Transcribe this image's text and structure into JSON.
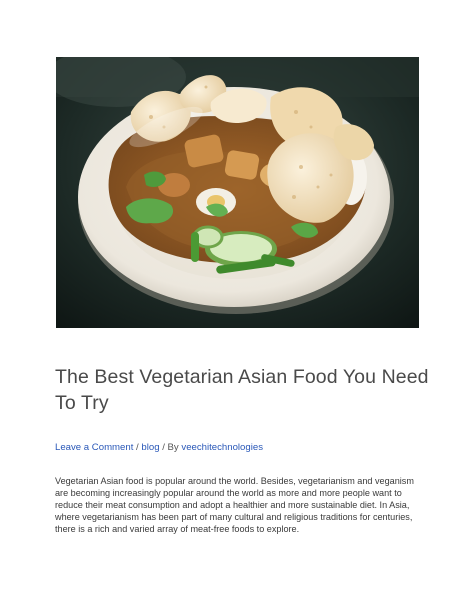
{
  "article": {
    "image_alt": "Vegetarian Asian dish with prawn crackers, vegetables and peanut sauce on a white plate",
    "title": "The Best Vegetarian Asian Food You Need To Try",
    "meta": {
      "comment_link": "Leave a Comment",
      "separator_1": " / ",
      "category_link": "blog",
      "separator_2": " / By ",
      "author_link": "veechitechnologies"
    },
    "intro": "Vegetarian Asian food is popular around the world. Besides, vegetarianism and veganism are becoming increasingly popular around the world as more and more people want to reduce their meat consumption and adopt a healthier and more sustainable diet. In Asia, where vegetarianism has been part of many cultural and religious traditions for centuries, there is a rich and varied array of meat-free foods to explore."
  },
  "colors": {
    "link": "#2a58b8",
    "title": "#4a4a4a",
    "body": "#3a3a3a"
  }
}
